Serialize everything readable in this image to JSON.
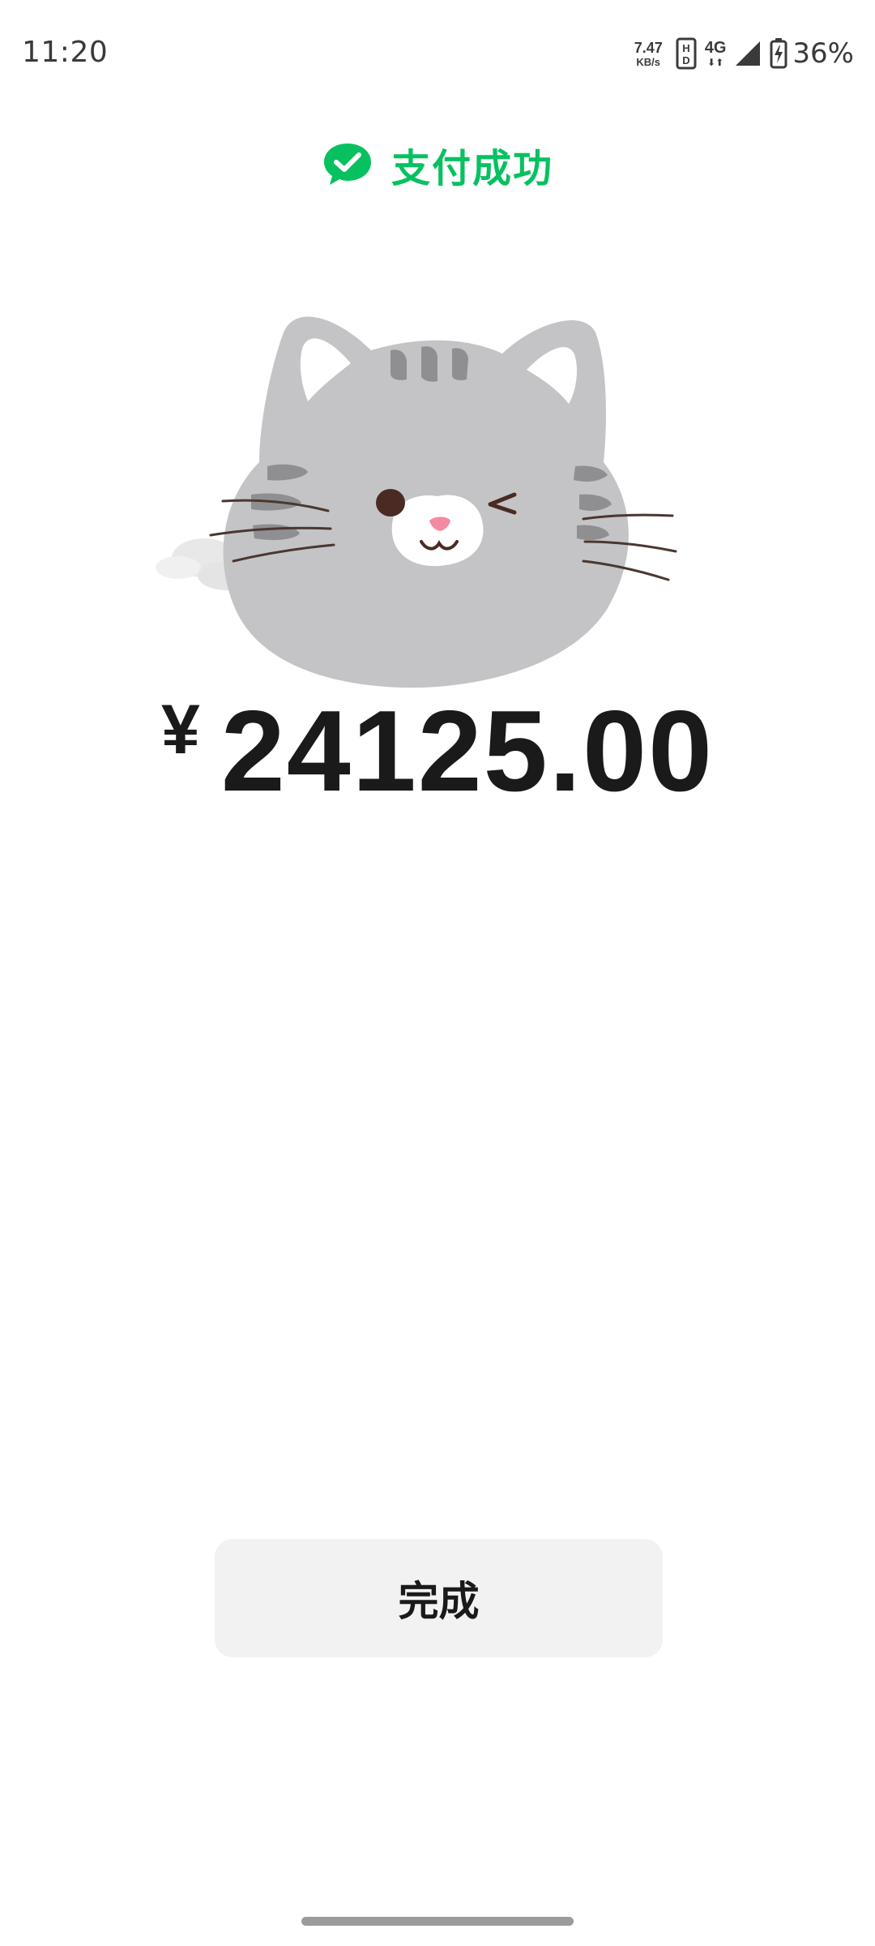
{
  "status_bar": {
    "time": "11:20",
    "net_speed_value": "7.47",
    "net_speed_unit": "KB/s",
    "hd_icon": "hd-voice-icon",
    "mobile_data_label": "4G",
    "mobile_data_arrows": "⬇⬆",
    "signal_icon": "cell-signal-icon",
    "battery_icon": "battery-charging-icon",
    "battery_percent": "36%"
  },
  "header": {
    "icon": "wechat-pay-check-icon",
    "title": "支付成功",
    "accent_color": "#07c160"
  },
  "illustration": {
    "icon": "winking-cat-illustration"
  },
  "amount": {
    "currency_symbol": "¥",
    "value": "24125.00"
  },
  "actions": {
    "done_label": "完成"
  }
}
